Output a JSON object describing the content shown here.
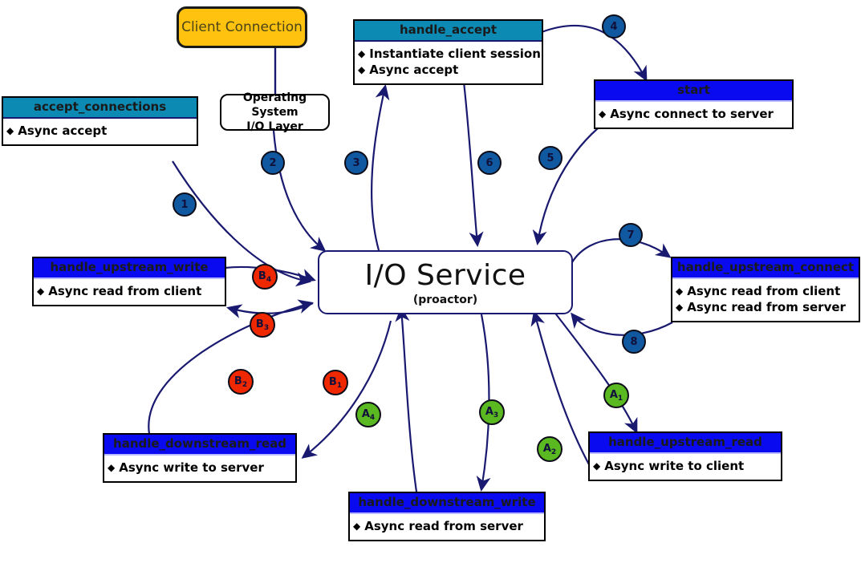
{
  "diagram": {
    "title": "I/O Service proactor interaction diagram",
    "colors": {
      "teal_header": "#0c8ab4",
      "blue_header": "#0a0af0",
      "gold": "#ffc20e",
      "badge_blue": "#1058a0",
      "badge_red": "#f02800",
      "badge_green": "#5ab820",
      "edge": "#191970"
    }
  },
  "center": {
    "title": "I/O Service",
    "subtitle": "(proactor)"
  },
  "client_connection": {
    "label": "Client Connection"
  },
  "os_layer": {
    "line1": "Operating System",
    "line2": "I/O Layer"
  },
  "boxes": [
    {
      "id": "accept_connections",
      "title": "accept_connections",
      "header_style": "teal",
      "items": [
        "Async accept"
      ]
    },
    {
      "id": "handle_accept",
      "title": "handle_accept",
      "header_style": "teal",
      "items": [
        "Instantiate client session",
        "Async accept"
      ]
    },
    {
      "id": "start",
      "title": "start",
      "header_style": "blue",
      "items": [
        "Async connect to server"
      ]
    },
    {
      "id": "handle_upstream_write",
      "title": "handle_upstream_write",
      "header_style": "blue",
      "items": [
        "Async read from client"
      ]
    },
    {
      "id": "handle_upstream_connect",
      "title": "handle_upstream_connect",
      "header_style": "blue",
      "items": [
        "Async read from client",
        "Async read from server"
      ]
    },
    {
      "id": "handle_downstream_read",
      "title": "handle_downstream_read",
      "header_style": "blue",
      "items": [
        "Async write to server"
      ]
    },
    {
      "id": "handle_downstream_write",
      "title": "handle_downstream_write",
      "header_style": "blue",
      "items": [
        "Async read from server"
      ]
    },
    {
      "id": "handle_upstream_read",
      "title": "handle_upstream_read",
      "header_style": "blue",
      "items": [
        "Async write to client"
      ]
    }
  ],
  "badges": {
    "numbers": [
      "1",
      "2",
      "3",
      "4",
      "5",
      "6",
      "7",
      "8"
    ],
    "red": [
      {
        "letter": "B",
        "sub": "1"
      },
      {
        "letter": "B",
        "sub": "2"
      },
      {
        "letter": "B",
        "sub": "3"
      },
      {
        "letter": "B",
        "sub": "4"
      }
    ],
    "green": [
      {
        "letter": "A",
        "sub": "1"
      },
      {
        "letter": "A",
        "sub": "2"
      },
      {
        "letter": "A",
        "sub": "3"
      },
      {
        "letter": "A",
        "sub": "4"
      }
    ]
  },
  "bullet_glyph": "◆"
}
